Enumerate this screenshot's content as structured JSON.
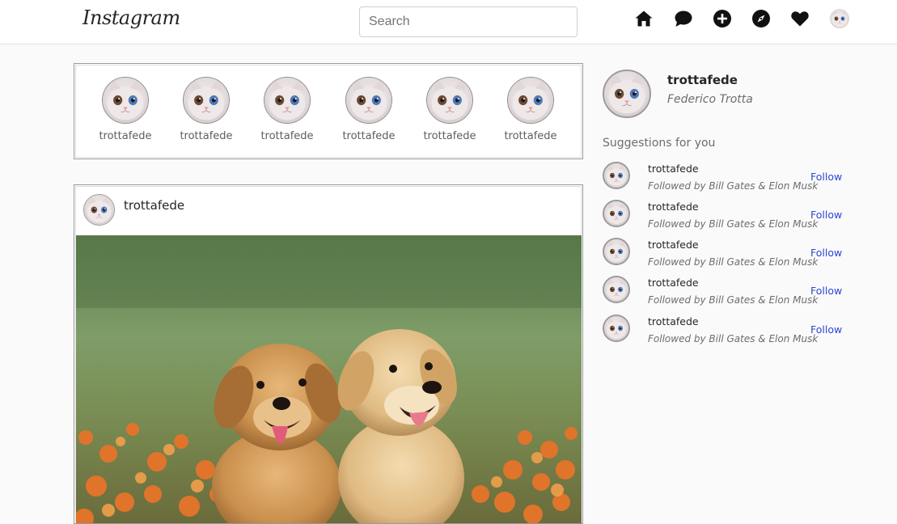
{
  "app": {
    "logo": "Instagram"
  },
  "search": {
    "placeholder": "Search",
    "value": ""
  },
  "nav": {
    "icons": [
      "home-icon",
      "messages-icon",
      "new-post-icon",
      "explore-icon",
      "activity-heart-icon",
      "profile-avatar"
    ]
  },
  "stories": [
    {
      "username": "trottafede"
    },
    {
      "username": "trottafede"
    },
    {
      "username": "trottafede"
    },
    {
      "username": "trottafede"
    },
    {
      "username": "trottafede"
    },
    {
      "username": "trottafede"
    }
  ],
  "post": {
    "username": "trottafede",
    "image": "two golden retriever puppies in a field of orange flowers"
  },
  "profile": {
    "username": "trottafede",
    "full_name": "Federico Trotta"
  },
  "suggestions": {
    "title": "Suggestions for you",
    "items": [
      {
        "username": "trottafede",
        "subtitle": "Followed by Bill Gates & Elon Musk",
        "action": "Follow"
      },
      {
        "username": "trottafede",
        "subtitle": "Followed by Bill Gates & Elon Musk",
        "action": "Follow"
      },
      {
        "username": "trottafede",
        "subtitle": "Followed by Bill Gates & Elon Musk",
        "action": "Follow"
      },
      {
        "username": "trottafede",
        "subtitle": "Followed by Bill Gates & Elon Musk",
        "action": "Follow"
      },
      {
        "username": "trottafede",
        "subtitle": "Followed by Bill Gates & Elon Musk",
        "action": "Follow"
      }
    ]
  },
  "colors": {
    "follow_link": "#2c46d6",
    "background": "#fafafa",
    "border": "#9a9a9a"
  }
}
